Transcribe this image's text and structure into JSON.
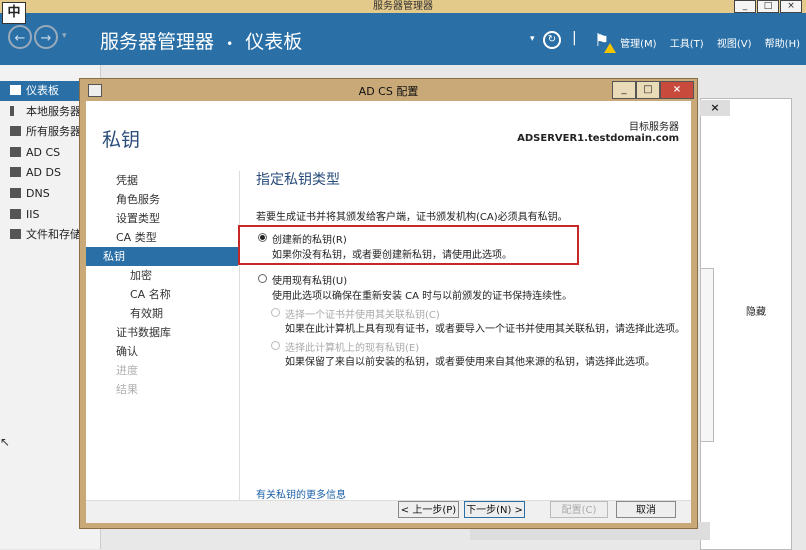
{
  "window": {
    "title": "服务器管理器",
    "ime_indicator": "中",
    "controls": [
      "_",
      "□",
      "×"
    ]
  },
  "header": {
    "breadcrumb_app": "服务器管理器",
    "breadcrumb_sep": "•",
    "breadcrumb_page": "仪表板",
    "nav_back": "←",
    "nav_forward": "→",
    "nav_dropdown": "▾",
    "refresh_dropdown": "▾",
    "refresh_glyph": "↻",
    "separator": "|",
    "menus": [
      "管理(M)",
      "工具(T)",
      "视图(V)",
      "帮助(H)"
    ]
  },
  "sidebar": {
    "items": [
      {
        "label": "仪表板",
        "active": true
      },
      {
        "label": "本地服务器"
      },
      {
        "label": "所有服务器"
      },
      {
        "label": "AD CS"
      },
      {
        "label": "AD DS"
      },
      {
        "label": "DNS"
      },
      {
        "label": "IIS"
      },
      {
        "label": "文件和存储服务"
      }
    ]
  },
  "background": {
    "close_label": "×",
    "hide_label": "隐藏"
  },
  "dialog": {
    "title": "AD CS 配置",
    "controls": [
      "_",
      "□",
      "×"
    ],
    "heading": "私钥",
    "target_label": "目标服务器",
    "target_server": "ADSERVER1.testdomain.com",
    "nav": [
      {
        "label": "凭据"
      },
      {
        "label": "角色服务"
      },
      {
        "label": "设置类型"
      },
      {
        "label": "CA 类型"
      },
      {
        "label": "私钥",
        "active": true
      },
      {
        "label": "加密",
        "sub": true
      },
      {
        "label": "CA 名称",
        "sub": true
      },
      {
        "label": "有效期",
        "sub": true
      },
      {
        "label": "证书数据库"
      },
      {
        "label": "确认"
      },
      {
        "label": "进度",
        "disabled": true
      },
      {
        "label": "结果",
        "disabled": true
      }
    ],
    "content": {
      "title": "指定私钥类型",
      "intro": "若要生成证书并将其颁发给客户端，证书颁发机构(CA)必须具有私钥。",
      "option_new": {
        "label": "创建新的私钥(R)",
        "desc": "如果你没有私钥，或者要创建新私钥，请使用此选项。",
        "checked": true
      },
      "option_existing": {
        "label": "使用现有私钥(U)",
        "desc": "使用此选项以确保在重新安装 CA 时与以前颁发的证书保持连续性。"
      },
      "sub_cert": {
        "label": "选择一个证书并使用其关联私钥(C)",
        "desc": "如果在此计算机上具有现有证书，或者要导入一个证书并使用其关联私钥，请选择此选项。"
      },
      "sub_key": {
        "label": "选择此计算机上的现有私钥(E)",
        "desc": "如果保留了来自以前安装的私钥，或者要使用来自其他来源的私钥，请选择此选项。"
      },
      "more_info": "有关私钥的更多信息"
    },
    "footer": {
      "back": "< 上一步(P)",
      "next": "下一步(N) >",
      "configure": "配置(C)",
      "cancel": "取消"
    }
  }
}
